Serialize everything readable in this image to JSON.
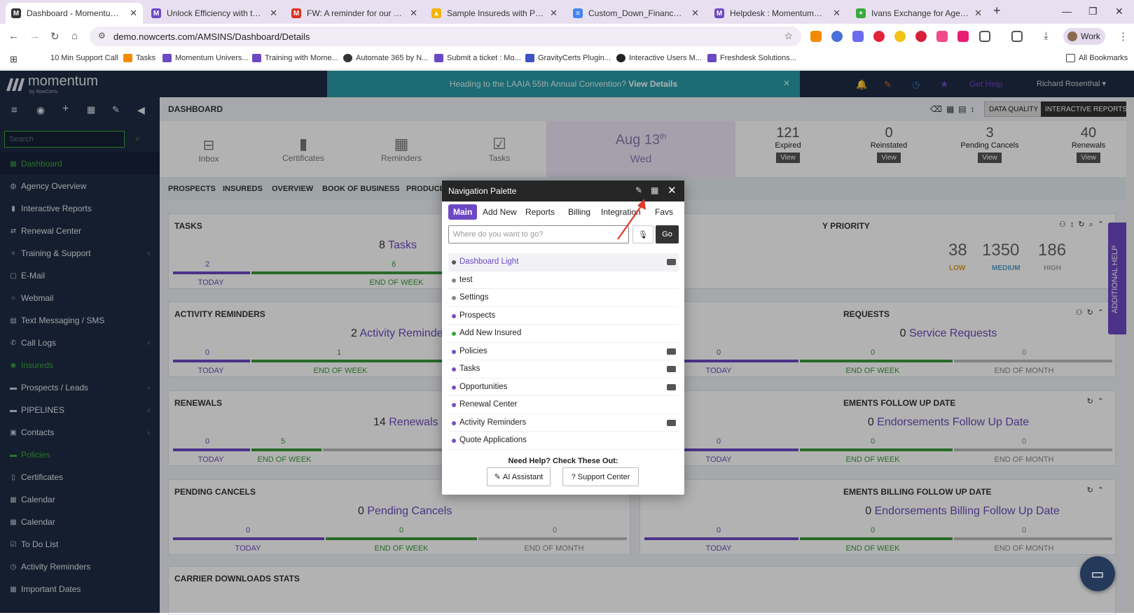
{
  "browser": {
    "tabs": [
      {
        "title": "Dashboard - Momentum AMS",
        "active": true
      },
      {
        "title": "Unlock Efficiency with the Navig"
      },
      {
        "title": "FW: A reminder for our upcomi"
      },
      {
        "title": "Sample Insureds with Policies -"
      },
      {
        "title": "Custom_Down_Finance_Agreem"
      },
      {
        "title": "Helpdesk : MomentumAMP"
      },
      {
        "title": "Ivans Exchange for Agents | Iva"
      }
    ],
    "url": "demo.nowcerts.com/AMSINS/Dashboard/Details",
    "profile": "Work",
    "bookmarks": [
      "10 Min Support Call",
      "Tasks",
      "Momentum Univers...",
      "Training with Mome...",
      "Automate 365 by N...",
      "Submit a ticket : Mo...",
      "GravityCerts Plugin...",
      "Interactive Users M...",
      "Freshdesk Solutions..."
    ],
    "all_bookmarks": "All Bookmarks"
  },
  "app": {
    "logo": "momentum",
    "logo_sub": "by NowCerts",
    "banner_text": "Heading to the LAAIA 55th Annual Convention?",
    "banner_link": "View Details",
    "get_help": "Get Help",
    "user": "Richard Rosenthal",
    "search_placeholder": "Search",
    "page_title": "DASHBOARD",
    "data_quality": "DATA QUALITY",
    "interactive_reports": "INTERACTIVE REPORTS",
    "additional_help": "ADDITIONAL HELP"
  },
  "sidebar": {
    "items": [
      {
        "label": "Dashboard"
      },
      {
        "label": "Agency Overview"
      },
      {
        "label": "Interactive Reports"
      },
      {
        "label": "Renewal Center"
      },
      {
        "label": "Training & Support"
      },
      {
        "label": "E-Mail"
      },
      {
        "label": "Webmail"
      },
      {
        "label": "Text Messaging / SMS"
      },
      {
        "label": "Call Logs"
      },
      {
        "label": "Insureds"
      },
      {
        "label": "Prospects / Leads"
      },
      {
        "label": "PIPELINES"
      },
      {
        "label": "Contacts"
      },
      {
        "label": "Policies"
      },
      {
        "label": "Certificates"
      },
      {
        "label": "Calendar"
      },
      {
        "label": "Calendar"
      },
      {
        "label": "To Do List"
      },
      {
        "label": "Activity Reminders"
      },
      {
        "label": "Important Dates"
      }
    ]
  },
  "quick": {
    "inbox": "Inbox",
    "certificates": "Certificates",
    "reminders": "Reminders",
    "tasks": "Tasks",
    "date": "Aug 13",
    "date_sup": "th",
    "weekday": "Wed",
    "stats": [
      {
        "value": "121",
        "label": "Expired",
        "button": "View"
      },
      {
        "value": "0",
        "label": "Reinstated",
        "button": "View"
      },
      {
        "value": "3",
        "label": "Pending Cancels",
        "button": "View"
      },
      {
        "value": "40",
        "label": "Renewals",
        "button": "View"
      }
    ]
  },
  "subnav": [
    "PROSPECTS",
    "INSUREDS",
    "OVERVIEW",
    "BOOK OF BUSINESS",
    "PRODUCE"
  ],
  "panels": {
    "tasks": {
      "title": "TASKS",
      "count": "8",
      "label": "Tasks",
      "today": "2",
      "eow": "6",
      "today_lbl": "TODAY",
      "eow_lbl": "END OF WEEK"
    },
    "priority": {
      "title": "Y PRIORITY",
      "low": "38",
      "medium": "1350",
      "high": "186",
      "low_lbl": "LOW",
      "medium_lbl": "MEDIUM",
      "high_lbl": "HIGH"
    },
    "activity": {
      "title": "ACTIVITY REMINDERS",
      "count": "2",
      "label": "Activity Reminde",
      "today": "0",
      "eow": "1",
      "today_lbl": "TODAY",
      "eow_lbl": "END OF WEEK"
    },
    "service": {
      "title": "REQUESTS",
      "count": "0",
      "label": "Service Requests",
      "today": "0",
      "eow": "0",
      "eom": "0",
      "today_lbl": "TODAY",
      "eow_lbl": "END OF WEEK",
      "eom_lbl": "END OF MONTH"
    },
    "renewals": {
      "title": "RENEWALS",
      "count": "14",
      "label": "Renewals",
      "today": "0",
      "eow": "5",
      "today_lbl": "TODAY",
      "eow_lbl": "END OF WEEK"
    },
    "endorse": {
      "title": "EMENTS FOLLOW UP DATE",
      "count": "0",
      "label": "Endorsements Follow Up Date",
      "today": "0",
      "eow": "0",
      "eom": "0",
      "today_lbl": "TODAY",
      "eow_lbl": "END OF WEEK",
      "eom_lbl": "END OF MONTH"
    },
    "pending": {
      "title": "PENDING CANCELS",
      "count": "0",
      "label": "Pending Cancels",
      "today": "0",
      "eow": "0",
      "eom": "0",
      "today_lbl": "TODAY",
      "eow_lbl": "END OF WEEK",
      "eom_lbl": "END OF MONTH"
    },
    "billing": {
      "title": "EMENTS BILLING FOLLOW UP DATE",
      "count": "0",
      "label": "Endorsements Billing Follow Up Date",
      "today": "0",
      "eow": "0",
      "eom": "0",
      "today_lbl": "TODAY",
      "eow_lbl": "END OF WEEK",
      "eom_lbl": "END OF MONTH"
    },
    "carrier": {
      "title": "CARRIER DOWNLOADS STATS"
    }
  },
  "modal": {
    "title": "Navigation Palette",
    "tabs": [
      "Main",
      "Add New",
      "Reports",
      "Billing",
      "Integration",
      "Favs"
    ],
    "placeholder": "Where do you want to go?",
    "go": "Go",
    "items": [
      {
        "label": "Dashboard Light",
        "dot": "#555555",
        "kb": true
      },
      {
        "label": "test",
        "dot": "#888888",
        "kb": false
      },
      {
        "label": "Settings",
        "dot": "#888888",
        "kb": false
      },
      {
        "label": "Prospects",
        "dot": "#7a4fc4",
        "kb": false
      },
      {
        "label": "Add New Insured",
        "dot": "#3aa83c",
        "kb": false
      },
      {
        "label": "Policies",
        "dot": "#7a4fc4",
        "kb": true
      },
      {
        "label": "Tasks",
        "dot": "#7a4fc4",
        "kb": true
      },
      {
        "label": "Opportunities",
        "dot": "#7a4fc4",
        "kb": true
      },
      {
        "label": "Renewal Center",
        "dot": "#7a4fc4",
        "kb": false
      },
      {
        "label": "Activity Reminders",
        "dot": "#7a4fc4",
        "kb": true
      },
      {
        "label": "Quote Applications",
        "dot": "#7a4fc4",
        "kb": false
      }
    ],
    "help_title": "Need Help? Check These Out:",
    "ai_assistant": "AI Assistant",
    "support_center": "Support Center"
  },
  "colors": {
    "sidebar": "#1d2b43",
    "accent": "#6d48c4",
    "banner": "#2a9aa6",
    "green": "#3a9a3c"
  }
}
